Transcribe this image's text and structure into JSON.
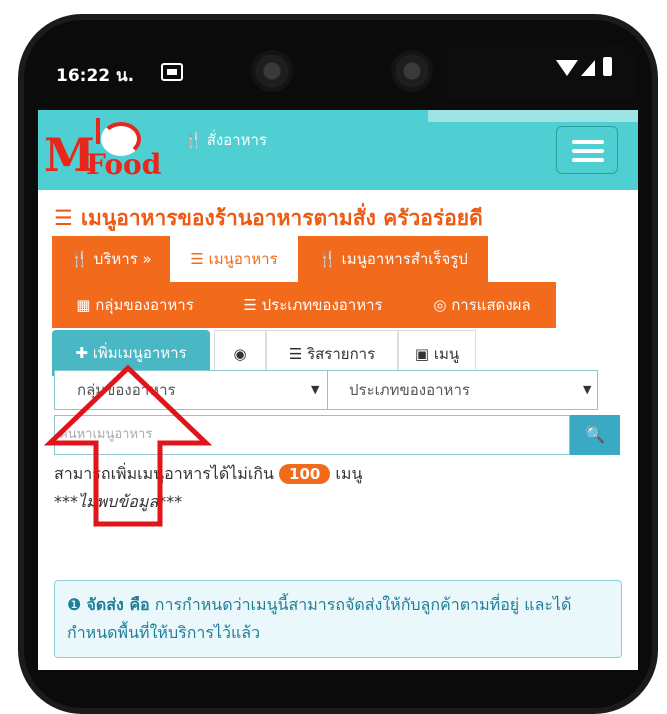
{
  "status_bar": {
    "time": "16:22 น.",
    "icons": [
      "image-icon",
      "camera-icon",
      "camera-icon",
      "wifi-icon",
      "signal-icon",
      "battery-icon"
    ]
  },
  "navbar": {
    "logo_m": "M",
    "logo_food": "Food",
    "order_label": "สั่งอาหาร",
    "accent": "#4fcfd1"
  },
  "page": {
    "title": "เมนูอาหารของร้านอาหารตามสั่ง ครัวอร่อยดี",
    "title_color": "#ee5a12"
  },
  "tabs_row1": [
    {
      "label": "บริหาร »",
      "active": false
    },
    {
      "label": "เมนูอาหาร",
      "active": true
    },
    {
      "label": "เมนูอาหารสำเร็จรูป",
      "active": false
    }
  ],
  "tabs_row2": [
    {
      "label": "กลุ่มของอาหาร"
    },
    {
      "label": "ประเภทของอาหาร"
    },
    {
      "label": "การแสดงผล"
    }
  ],
  "toolbar": {
    "add_label": "เพิ่มเมนูอาหาร",
    "target_symbol": "◉",
    "list_label": "ริสรายการ",
    "menu_label": "เมนู"
  },
  "filters": {
    "group_placeholder": "กลุ่มของอาหาร",
    "type_placeholder": "ประเภทของอาหาร"
  },
  "search": {
    "placeholder": "ค้นหาเมนูอาหาร"
  },
  "info": {
    "limit_prefix": "สามารถเพิ่มเมนูอาหารได้ไม่เกิน",
    "limit_value": "100",
    "limit_suffix": "เมนู",
    "not_found": "***ไม่พบข้อมูล***"
  },
  "callout": {
    "keyword": "จัดส่ง คือ",
    "text": "การกำหนดว่าเมนูนี้สามารถจัดส่งให้กับลูกค้าตามที่อยู่ และได้กำหนดพื้นที่ให้บริการไว้แล้ว"
  },
  "colors": {
    "orange": "#f26a1c",
    "teal_button": "#4ab7c5",
    "arrow": "#e0141b"
  }
}
